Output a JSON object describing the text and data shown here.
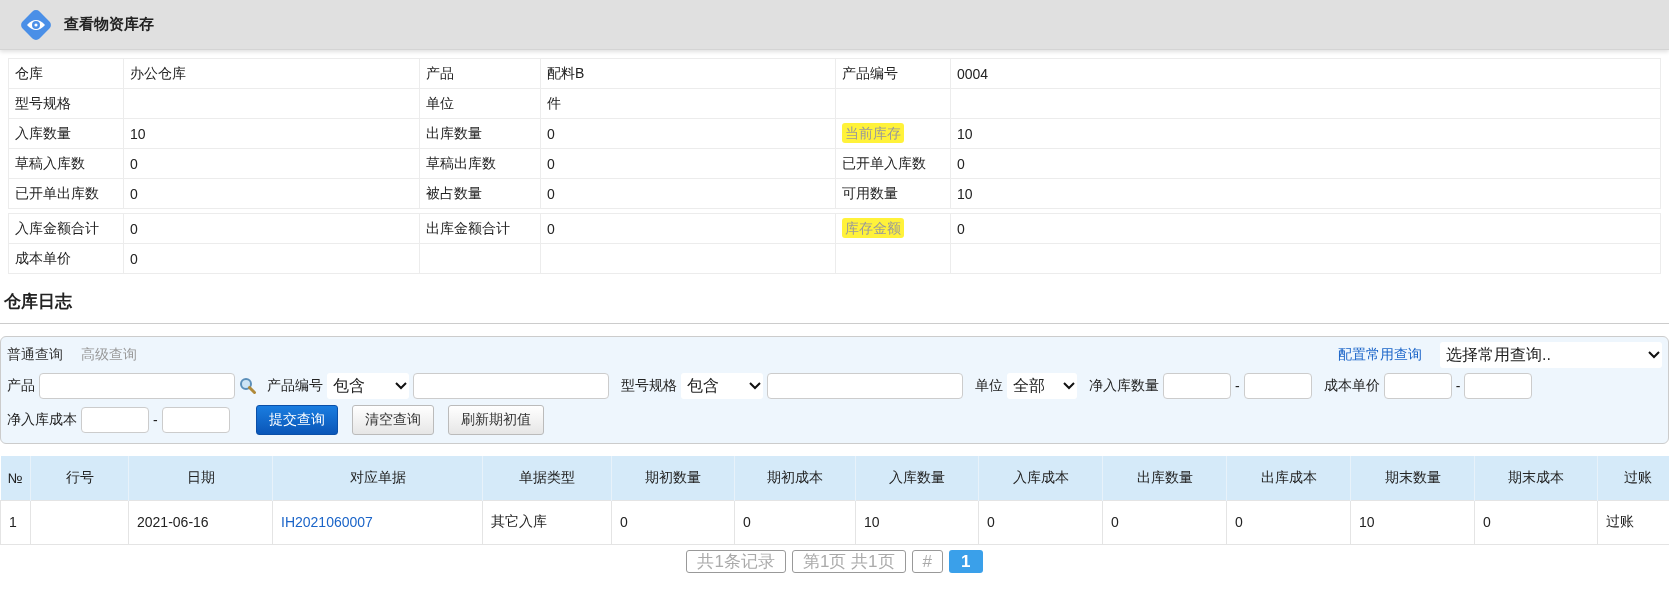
{
  "header": {
    "title": "查看物资库存"
  },
  "info_sections": [
    {
      "rows": [
        [
          {
            "label": "仓库",
            "value": "办公仓库",
            "highlighted": false
          },
          {
            "label": "产品",
            "value": "配料B",
            "highlighted": false
          },
          {
            "label": "产品编号",
            "value": "0004",
            "highlighted": false
          }
        ],
        [
          {
            "label": "型号规格",
            "highlighted": false
          },
          {
            "label": "单位",
            "value": "件",
            "highlighted": false
          },
          {}
        ],
        [
          {
            "label": "入库数量",
            "value": "10",
            "highlighted": false
          },
          {
            "label": "出库数量",
            "value": "0",
            "highlighted": false
          },
          {
            "label": "当前库存",
            "value": "10",
            "highlighted": true
          }
        ],
        [
          {
            "label": "草稿入库数",
            "value": "0",
            "highlighted": false
          },
          {
            "label": "草稿出库数",
            "value": "0",
            "highlighted": false
          },
          {
            "label": "已开单入库数",
            "value": "0",
            "highlighted": false
          }
        ],
        [
          {
            "label": "已开单出库数",
            "value": "0",
            "highlighted": false
          },
          {
            "label": "被占数量",
            "value": "0",
            "highlighted": false
          },
          {
            "label": "可用数量",
            "value": "10",
            "highlighted": false
          }
        ]
      ]
    },
    {
      "rows": [
        [
          {
            "label": "入库金额合计",
            "value": "0",
            "highlighted": false
          },
          {
            "label": "出库金额合计",
            "value": "0",
            "highlighted": false
          },
          {
            "label": "库存金额",
            "value": "0",
            "highlighted": true
          }
        ],
        [
          {
            "label": "成本单价",
            "value": "0",
            "highlighted": false
          },
          {},
          {}
        ]
      ]
    }
  ],
  "section_title": "仓库日志",
  "query": {
    "tabs": [
      {
        "label": "普通查询",
        "selected": true
      },
      {
        "label": "高级查询",
        "selected": false
      }
    ],
    "config_link": "配置常用查询",
    "preset_select": "选择常用查询..",
    "filter_rows": [
      [
        {
          "kind": "search",
          "label": "产品"
        },
        {
          "kind": "match",
          "label": "产品编号",
          "operator": "包含"
        },
        {
          "kind": "match",
          "label": "型号规格",
          "operator": "包含"
        },
        {
          "kind": "select",
          "label": "单位",
          "value": "全部"
        },
        {
          "kind": "range",
          "label": "净入库数量",
          "separator": "-"
        },
        {
          "kind": "range",
          "label": "成本单价",
          "separator": "-"
        }
      ],
      [
        {
          "kind": "range",
          "label": "净入库成本",
          "separator": "-"
        }
      ]
    ],
    "buttons": [
      {
        "label": "提交查询",
        "primary": true
      },
      {
        "label": "清空查询",
        "primary": false
      },
      {
        "label": "刷新期初值",
        "primary": false
      }
    ]
  },
  "table": {
    "columns": [
      "№",
      "行号",
      "日期",
      "对应单据",
      "单据类型",
      "期初数量",
      "期初成本",
      "入库数量",
      "入库成本",
      "出库数量",
      "出库成本",
      "期末数量",
      "期末成本",
      "过账"
    ],
    "rows": [
      {
        "cells": [
          {
            "kind": "text",
            "text": "1"
          },
          null,
          {
            "kind": "text",
            "text": "2021-06-16"
          },
          {
            "kind": "link",
            "text": "IH2021060007"
          },
          {
            "kind": "text",
            "text": "其它入库"
          },
          {
            "kind": "text",
            "text": "0"
          },
          {
            "kind": "text",
            "text": "0"
          },
          {
            "kind": "text",
            "text": "10"
          },
          {
            "kind": "text",
            "text": "0"
          },
          {
            "kind": "text",
            "text": "0"
          },
          {
            "kind": "text",
            "text": "0"
          },
          {
            "kind": "text",
            "text": "10"
          },
          {
            "kind": "text",
            "text": "0"
          },
          {
            "kind": "text",
            "text": "过账"
          }
        ]
      }
    ]
  },
  "pagination": {
    "info": [
      "共1条记录",
      "第1页 共1页",
      "#"
    ],
    "pages": [
      {
        "label": "1",
        "selected": true
      }
    ]
  }
}
